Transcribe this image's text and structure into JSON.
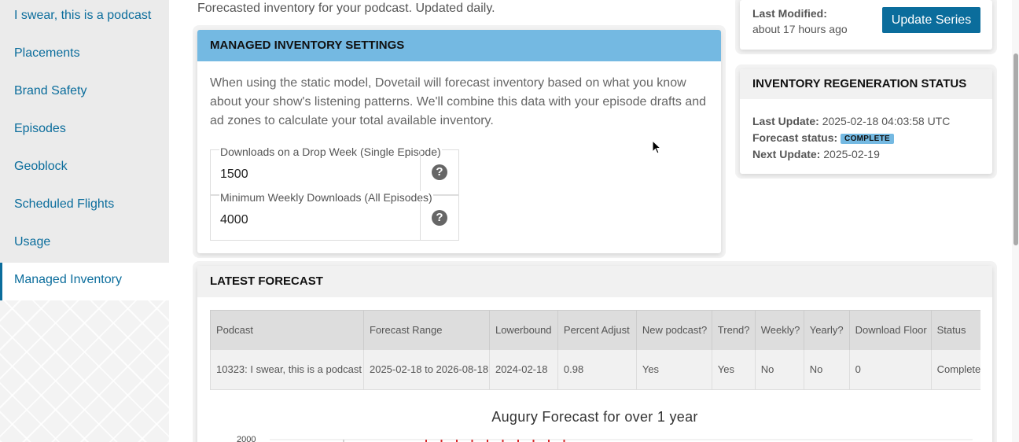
{
  "sidebar": {
    "items": [
      {
        "label": "I swear, this is a podcast",
        "active": false
      },
      {
        "label": "Placements",
        "active": false
      },
      {
        "label": "Brand Safety",
        "active": false
      },
      {
        "label": "Episodes",
        "active": false
      },
      {
        "label": "Geoblock",
        "active": false
      },
      {
        "label": "Scheduled Flights",
        "active": false
      },
      {
        "label": "Usage",
        "active": false
      },
      {
        "label": "Managed Inventory",
        "active": true
      }
    ]
  },
  "page": {
    "lead": "Forecasted inventory for your podcast. Updated daily."
  },
  "settings": {
    "title": "MANAGED INVENTORY SETTINGS",
    "description": "When using the static model, Dovetail will forecast inventory based on what you know about your show's listening patterns. We'll combine this data with your episode drafts and ad zones to calculate your total available inventory.",
    "fields": [
      {
        "label": "Downloads on a Drop Week (Single Episode)",
        "value": "1500"
      },
      {
        "label": "Minimum Weekly Downloads (All Episodes)",
        "value": "4000"
      }
    ],
    "help_glyph": "?"
  },
  "series": {
    "last_modified_label": "Last Modified:",
    "last_modified_value": "about 17 hours ago",
    "update_button": "Update Series"
  },
  "regen": {
    "title": "INVENTORY REGENERATION STATUS",
    "last_update_label": "Last Update:",
    "last_update_value": "2025-02-18 04:03:58 UTC",
    "status_label": "Forecast status:",
    "status_value": "COMPLETE",
    "next_update_label": "Next Update:",
    "next_update_value": "2025-02-19"
  },
  "forecast": {
    "title": "LATEST FORECAST",
    "columns": [
      "Podcast",
      "Forecast Range",
      "Lowerbound",
      "Percent Adjust",
      "New podcast?",
      "Trend?",
      "Weekly?",
      "Yearly?",
      "Download Floor",
      "Status"
    ],
    "rows": [
      [
        "10323: I swear, this is a podcast",
        "2025-02-18 to 2026-08-18",
        "2024-02-18",
        "0.98",
        "Yes",
        "Yes",
        "No",
        "No",
        "0",
        "Complete"
      ]
    ],
    "chart_title": "Augury Forecast for over 1 year"
  },
  "chart_data": {
    "type": "line",
    "title": "Augury Forecast for over 1 year",
    "y_tick_visible": "2000",
    "series_color": "#d62728"
  },
  "colors": {
    "brand": "#0b6d9c",
    "header_blue": "#74b9e2",
    "badge": "#74b9e2"
  }
}
